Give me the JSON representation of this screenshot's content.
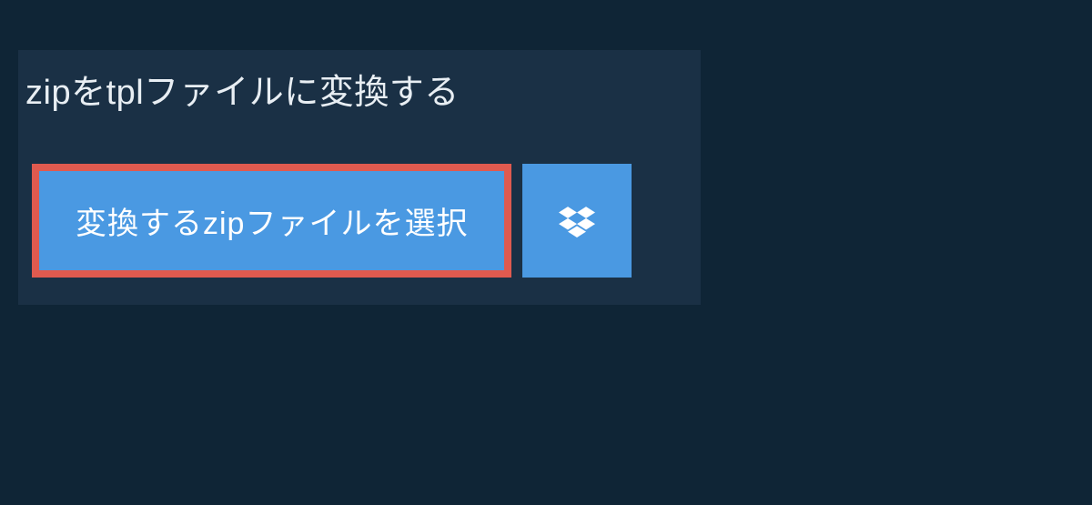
{
  "heading": "zipをtplファイルに変換する",
  "buttons": {
    "select_label": "変換するzipファイルを選択"
  },
  "colors": {
    "background": "#0f2536",
    "panel": "#1a3045",
    "accent": "#4a99e2",
    "highlight_border": "#e05a4f",
    "text": "#e8eef3"
  }
}
